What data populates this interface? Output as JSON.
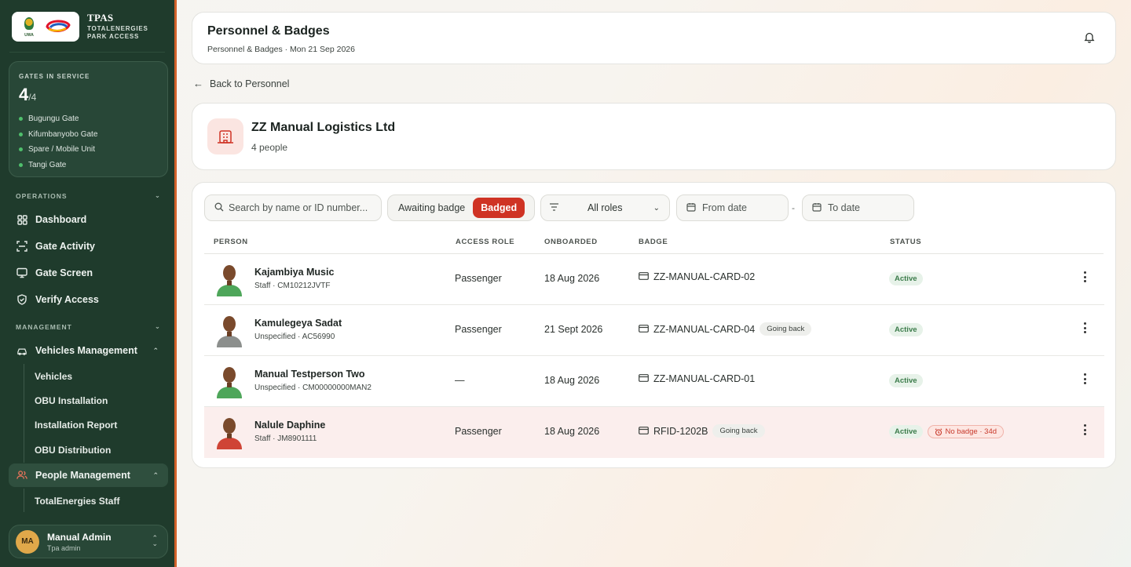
{
  "brand": {
    "title": "TPAS",
    "subtitle_line1": "TOTALENERGIES",
    "subtitle_line2": "PARK ACCESS",
    "uwa_logo_text": "UWA"
  },
  "gates": {
    "label": "GATES IN SERVICE",
    "count": "4",
    "total": "/4",
    "list": [
      "Bugungu Gate",
      "Kifumbanyobo Gate",
      "Spare / Mobile Unit",
      "Tangi Gate"
    ],
    "status_color": "#4fbf6c"
  },
  "nav": {
    "operations_label": "OPERATIONS",
    "operations": [
      {
        "label": "Dashboard",
        "icon": "grid-icon"
      },
      {
        "label": "Gate Activity",
        "icon": "scan-icon"
      },
      {
        "label": "Gate Screen",
        "icon": "monitor-icon"
      },
      {
        "label": "Verify Access",
        "icon": "shield-check-icon"
      }
    ],
    "management_label": "MANAGEMENT",
    "vehicles": {
      "label": "Vehicles Management",
      "icon": "car-icon",
      "items": [
        "Vehicles",
        "OBU Installation",
        "Installation Report",
        "OBU Distribution"
      ]
    },
    "people": {
      "label": "People Management",
      "icon": "users-icon",
      "items": [
        "TotalEnergies Staff"
      ]
    }
  },
  "user": {
    "initials": "MA",
    "name": "Manual Admin",
    "role": "Tpa admin"
  },
  "header": {
    "title": "Personnel & Badges",
    "subtitle": "Personnel & Badges · Mon 21 Sep 2026"
  },
  "back_label": "Back to Personnel",
  "company": {
    "name": "ZZ Manual Logistics Ltd",
    "count": "4 people",
    "icon_bg": "#fbe5e1",
    "icon_color": "#cf3324"
  },
  "filters": {
    "search_placeholder": "Search by name or ID number...",
    "toggle": [
      "Awaiting badge",
      "Badged"
    ],
    "toggle_selected": "Badged",
    "roles": "All roles",
    "from_date": "From date",
    "date_sep": "-",
    "to_date": "To date"
  },
  "table": {
    "headers": {
      "person": "PERSON",
      "role": "ACCESS ROLE",
      "onboarded": "ONBOARDED",
      "badge": "BADGE",
      "status": "STATUS"
    },
    "rows": [
      {
        "name": "Kajambiya Music",
        "meta": "Staff · CM10212JVTF",
        "role": "Passenger",
        "onboarded": "18 Aug 2026",
        "badge": "ZZ-MANUAL-CARD-02",
        "badge_tag": "",
        "status": "Active",
        "alert": "",
        "shirt": "#4ea65a"
      },
      {
        "name": "Kamulegeya Sadat",
        "meta": "Unspecified · AC56990",
        "role": "Passenger",
        "onboarded": "21 Sept 2026",
        "badge": "ZZ-MANUAL-CARD-04",
        "badge_tag": "Going back",
        "status": "Active",
        "alert": "",
        "shirt": "#8c8f8d"
      },
      {
        "name": "Manual Testperson Two",
        "meta": "Unspecified · CM00000000MAN2",
        "role": "—",
        "onboarded": "18 Aug 2026",
        "badge": "ZZ-MANUAL-CARD-01",
        "badge_tag": "",
        "status": "Active",
        "alert": "",
        "shirt": "#4ea65a"
      },
      {
        "name": "Nalule Daphine",
        "meta": "Staff · JM8901111",
        "role": "Passenger",
        "onboarded": "18 Aug 2026",
        "badge": "RFID-1202B",
        "badge_tag": "Going back",
        "status": "Active",
        "alert": "No badge · 34d",
        "shirt": "#cf4436"
      }
    ]
  },
  "colors": {
    "sidebar": "#1f3b2c",
    "accent": "#cf3324",
    "active_green": "#3c7c4b"
  }
}
